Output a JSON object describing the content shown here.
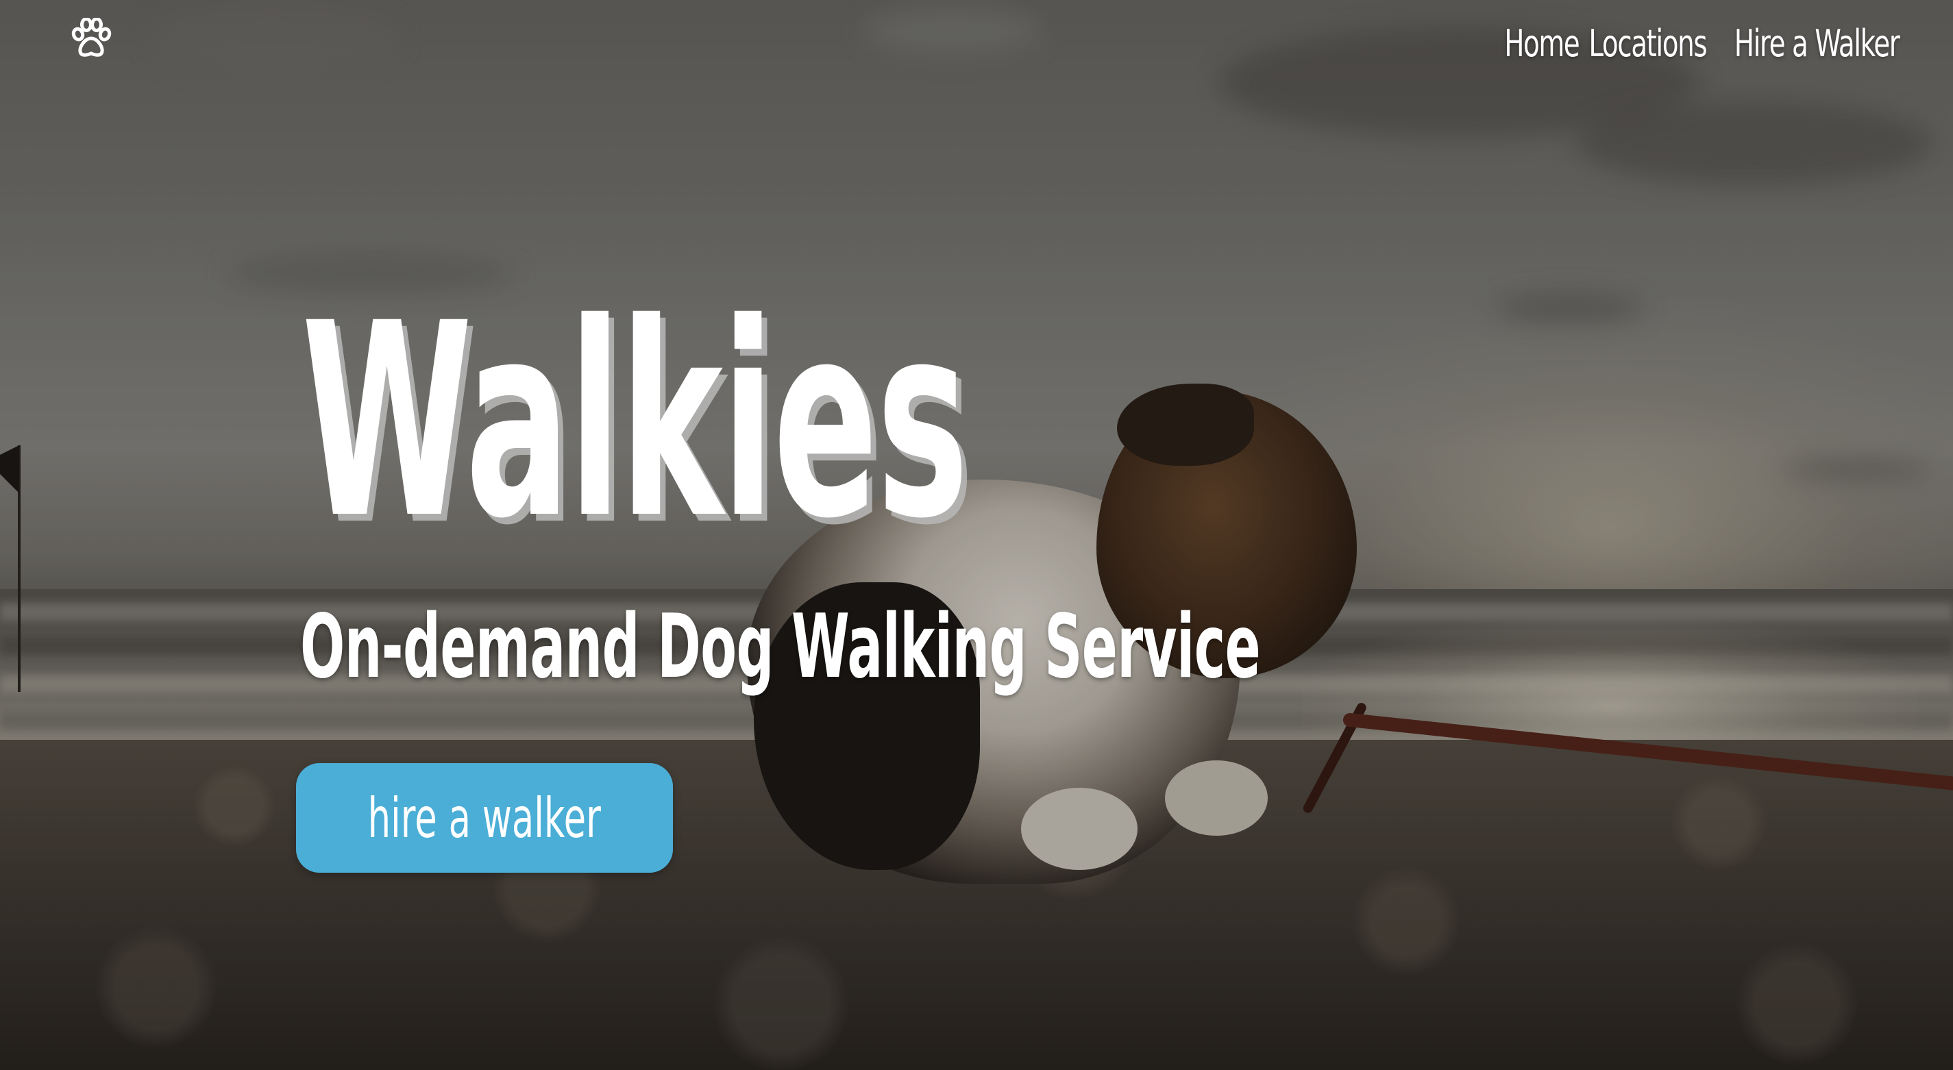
{
  "brand": {
    "logo_icon": "paw-icon"
  },
  "nav": {
    "items": [
      {
        "label": "Home"
      },
      {
        "label": "Locations"
      },
      {
        "label": "Hire a Walker"
      }
    ]
  },
  "hero": {
    "title": "Walkies",
    "subtitle": "On-demand Dog Walking Service",
    "cta_label": "hire a walker"
  },
  "colors": {
    "cta_background": "#4baed6",
    "text": "#ffffff"
  }
}
